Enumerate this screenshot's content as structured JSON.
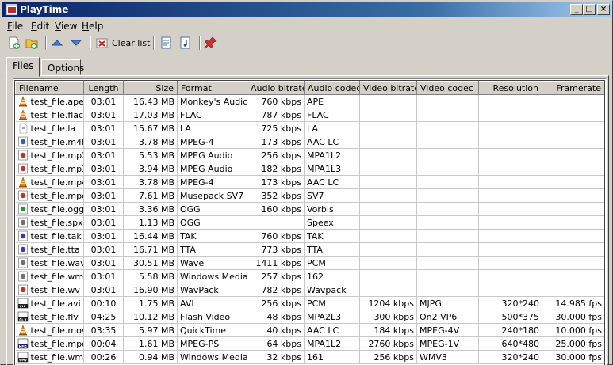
{
  "window": {
    "title": "PlayTime"
  },
  "menu": [
    {
      "label": "File",
      "accel": "F",
      "rest": "ile"
    },
    {
      "label": "Edit",
      "accel": "E",
      "rest": "dit"
    },
    {
      "label": "View",
      "accel": "V",
      "rest": "iew"
    },
    {
      "label": "Help",
      "accel": "H",
      "rest": "elp"
    }
  ],
  "toolbar": {
    "clear_label": "Clear list"
  },
  "tabs": [
    {
      "label": "Files"
    },
    {
      "label": "Options"
    }
  ],
  "table": {
    "columns": [
      "Filename",
      "Length",
      "Size",
      "Format",
      "Audio bitrate",
      "Audio codec",
      "Video bitrate",
      "Video codec",
      "Resolution",
      "Framerate"
    ],
    "rows": [
      {
        "icon": "cone",
        "filename": "test_file.ape",
        "length": "03:01",
        "size": "16.43 MB",
        "format": "Monkey's Audio",
        "audio_bitrate": "760 kbps",
        "audio_codec": "APE",
        "video_bitrate": "",
        "video_codec": "",
        "resolution": "",
        "framerate": ""
      },
      {
        "icon": "cone",
        "filename": "test_file.flac",
        "length": "03:01",
        "size": "17.03 MB",
        "format": "FLAC",
        "audio_bitrate": "787 kbps",
        "audio_codec": "FLAC",
        "video_bitrate": "",
        "video_codec": "",
        "resolution": "",
        "framerate": ""
      },
      {
        "icon": "blank",
        "filename": "test_file.la",
        "length": "03:01",
        "size": "15.67 MB",
        "format": "LA",
        "audio_bitrate": "725 kbps",
        "audio_codec": "LA",
        "video_bitrate": "",
        "video_codec": "",
        "resolution": "",
        "framerate": ""
      },
      {
        "icon": "blue",
        "filename": "test_file.m4b",
        "length": "03:01",
        "size": "3.78 MB",
        "format": "MPEG-4",
        "audio_bitrate": "173 kbps",
        "audio_codec": "AAC LC",
        "video_bitrate": "",
        "video_codec": "",
        "resolution": "",
        "framerate": ""
      },
      {
        "icon": "red",
        "filename": "test_file.mp2",
        "length": "03:01",
        "size": "5.53 MB",
        "format": "MPEG Audio",
        "audio_bitrate": "256 kbps",
        "audio_codec": "MPA1L2",
        "video_bitrate": "",
        "video_codec": "",
        "resolution": "",
        "framerate": ""
      },
      {
        "icon": "red",
        "filename": "test_file.mp3",
        "length": "03:01",
        "size": "3.94 MB",
        "format": "MPEG Audio",
        "audio_bitrate": "182 kbps",
        "audio_codec": "MPA1L3",
        "video_bitrate": "",
        "video_codec": "",
        "resolution": "",
        "framerate": ""
      },
      {
        "icon": "cone",
        "filename": "test_file.mp4",
        "length": "03:01",
        "size": "3.78 MB",
        "format": "MPEG-4",
        "audio_bitrate": "173 kbps",
        "audio_codec": "AAC LC",
        "video_bitrate": "",
        "video_codec": "",
        "resolution": "",
        "framerate": ""
      },
      {
        "icon": "red",
        "filename": "test_file.mpc",
        "length": "03:01",
        "size": "7.61 MB",
        "format": "Musepack SV7",
        "audio_bitrate": "352 kbps",
        "audio_codec": "SV7",
        "video_bitrate": "",
        "video_codec": "",
        "resolution": "",
        "framerate": ""
      },
      {
        "icon": "green",
        "filename": "test_file.ogg",
        "length": "03:01",
        "size": "3.36 MB",
        "format": "OGG",
        "audio_bitrate": "160 kbps",
        "audio_codec": "Vorbis",
        "video_bitrate": "",
        "video_codec": "",
        "resolution": "",
        "framerate": ""
      },
      {
        "icon": "gray",
        "filename": "test_file.spx",
        "length": "03:01",
        "size": "1.13 MB",
        "format": "OGG",
        "audio_bitrate": "",
        "audio_codec": "Speex",
        "video_bitrate": "",
        "video_codec": "",
        "resolution": "",
        "framerate": ""
      },
      {
        "icon": "purple",
        "filename": "test_file.tak",
        "length": "03:01",
        "size": "16.44 MB",
        "format": "TAK",
        "audio_bitrate": "760 kbps",
        "audio_codec": "TAK",
        "video_bitrate": "",
        "video_codec": "",
        "resolution": "",
        "framerate": ""
      },
      {
        "icon": "purple",
        "filename": "test_file.tta",
        "length": "03:01",
        "size": "16.71 MB",
        "format": "TTA",
        "audio_bitrate": "773 kbps",
        "audio_codec": "TTA",
        "video_bitrate": "",
        "video_codec": "",
        "resolution": "",
        "framerate": ""
      },
      {
        "icon": "gray",
        "filename": "test_file.wav",
        "length": "03:01",
        "size": "30.51 MB",
        "format": "Wave",
        "audio_bitrate": "1411 kbps",
        "audio_codec": "PCM",
        "video_bitrate": "",
        "video_codec": "",
        "resolution": "",
        "framerate": ""
      },
      {
        "icon": "gray",
        "filename": "test_file.wma",
        "length": "03:01",
        "size": "5.58 MB",
        "format": "Windows Media",
        "audio_bitrate": "257 kbps",
        "audio_codec": "162",
        "video_bitrate": "",
        "video_codec": "",
        "resolution": "",
        "framerate": ""
      },
      {
        "icon": "red",
        "filename": "test_file.wv",
        "length": "03:01",
        "size": "16.90 MB",
        "format": "WavPack",
        "audio_bitrate": "782 kbps",
        "audio_codec": "Wavpack",
        "video_bitrate": "",
        "video_codec": "",
        "resolution": "",
        "framerate": ""
      },
      {
        "icon": "avi",
        "filename": "test_file.avi",
        "length": "00:10",
        "size": "1.75 MB",
        "format": "AVI",
        "audio_bitrate": "256 kbps",
        "audio_codec": "PCM",
        "video_bitrate": "1204 kbps",
        "video_codec": "MJPG",
        "resolution": "320*240",
        "framerate": "14.985 fps"
      },
      {
        "icon": "flv",
        "filename": "test_file.flv",
        "length": "04:25",
        "size": "10.12 MB",
        "format": "Flash Video",
        "audio_bitrate": "48 kbps",
        "audio_codec": "MPA2L3",
        "video_bitrate": "300 kbps",
        "video_codec": "On2 VP6",
        "resolution": "500*375",
        "framerate": "30.000 fps"
      },
      {
        "icon": "cone",
        "filename": "test_file.mov",
        "length": "03:35",
        "size": "5.97 MB",
        "format": "QuickTime",
        "audio_bitrate": "40 kbps",
        "audio_codec": "AAC LC",
        "video_bitrate": "184 kbps",
        "video_codec": "MPEG-4V",
        "resolution": "240*180",
        "framerate": "10.000 fps"
      },
      {
        "icon": "mpg",
        "filename": "test_file.mpg",
        "length": "00:04",
        "size": "1.61 MB",
        "format": "MPEG-PS",
        "audio_bitrate": "64 kbps",
        "audio_codec": "MPA1L2",
        "video_bitrate": "2760 kbps",
        "video_codec": "MPEG-1V",
        "resolution": "640*480",
        "framerate": "25.000 fps"
      },
      {
        "icon": "wmv",
        "filename": "test_file.wmv",
        "length": "00:26",
        "size": "0.94 MB",
        "format": "Windows Media",
        "audio_bitrate": "32 kbps",
        "audio_codec": "161",
        "video_bitrate": "256 kbps",
        "video_codec": "WMV3",
        "resolution": "320*240",
        "framerate": "30.000 fps"
      }
    ]
  },
  "icons": {
    "cone": "vlc-cone-icon",
    "blank": "blank-file-icon",
    "blue": "blue-media-icon",
    "red": "red-media-icon",
    "green": "green-media-icon",
    "gray": "gray-media-icon",
    "purple": "purple-media-icon",
    "avi": "avi-file-icon",
    "flv": "flv-file-icon",
    "mpg": "mpg-file-icon",
    "wmv": "wmv-file-icon"
  }
}
